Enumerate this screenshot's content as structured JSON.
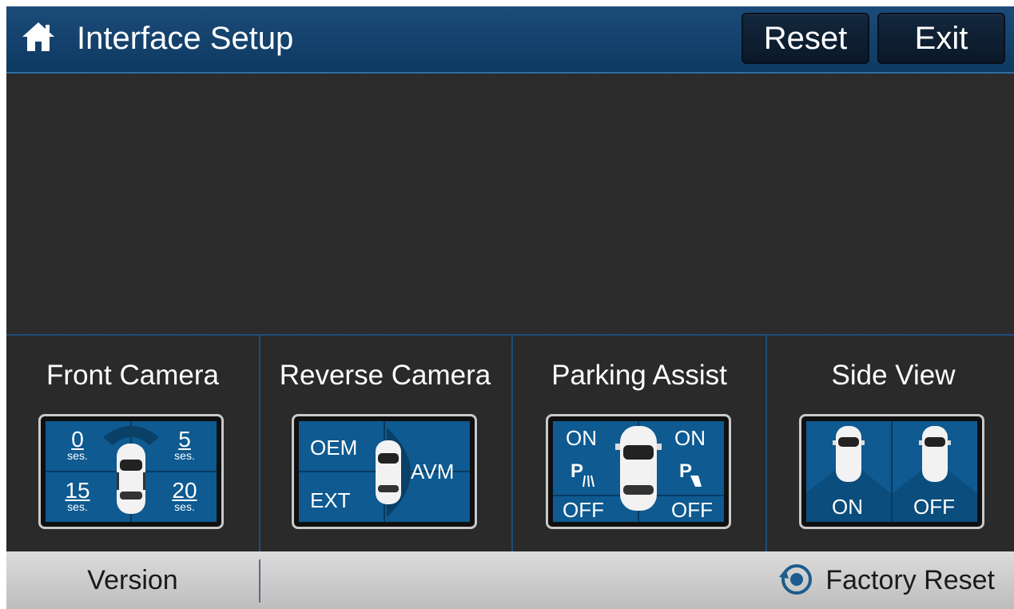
{
  "header": {
    "title": "Interface Setup",
    "reset_label": "Reset",
    "exit_label": "Exit",
    "icon": "home-icon"
  },
  "modes": [
    {
      "label": "Front Camera",
      "times": [
        "0",
        "5",
        "15",
        "20"
      ],
      "unit": "ses."
    },
    {
      "label": "Reverse Camera",
      "oem": "OEM",
      "ext": "EXT",
      "avm": "AVM"
    },
    {
      "label": "Parking Assist",
      "on_left": "ON",
      "on_right": "ON",
      "off_left": "OFF",
      "off_right": "OFF"
    },
    {
      "label": "Side View",
      "on": "ON",
      "off": "OFF"
    }
  ],
  "bottom": {
    "version_label": "Version",
    "factory_reset_label": "Factory Reset",
    "icon": "factory-reset-icon"
  },
  "colors": {
    "header": "#0d3a62",
    "panel": "#0e5a91",
    "background": "#2a2a2a",
    "bar": "#cfcfcf"
  }
}
